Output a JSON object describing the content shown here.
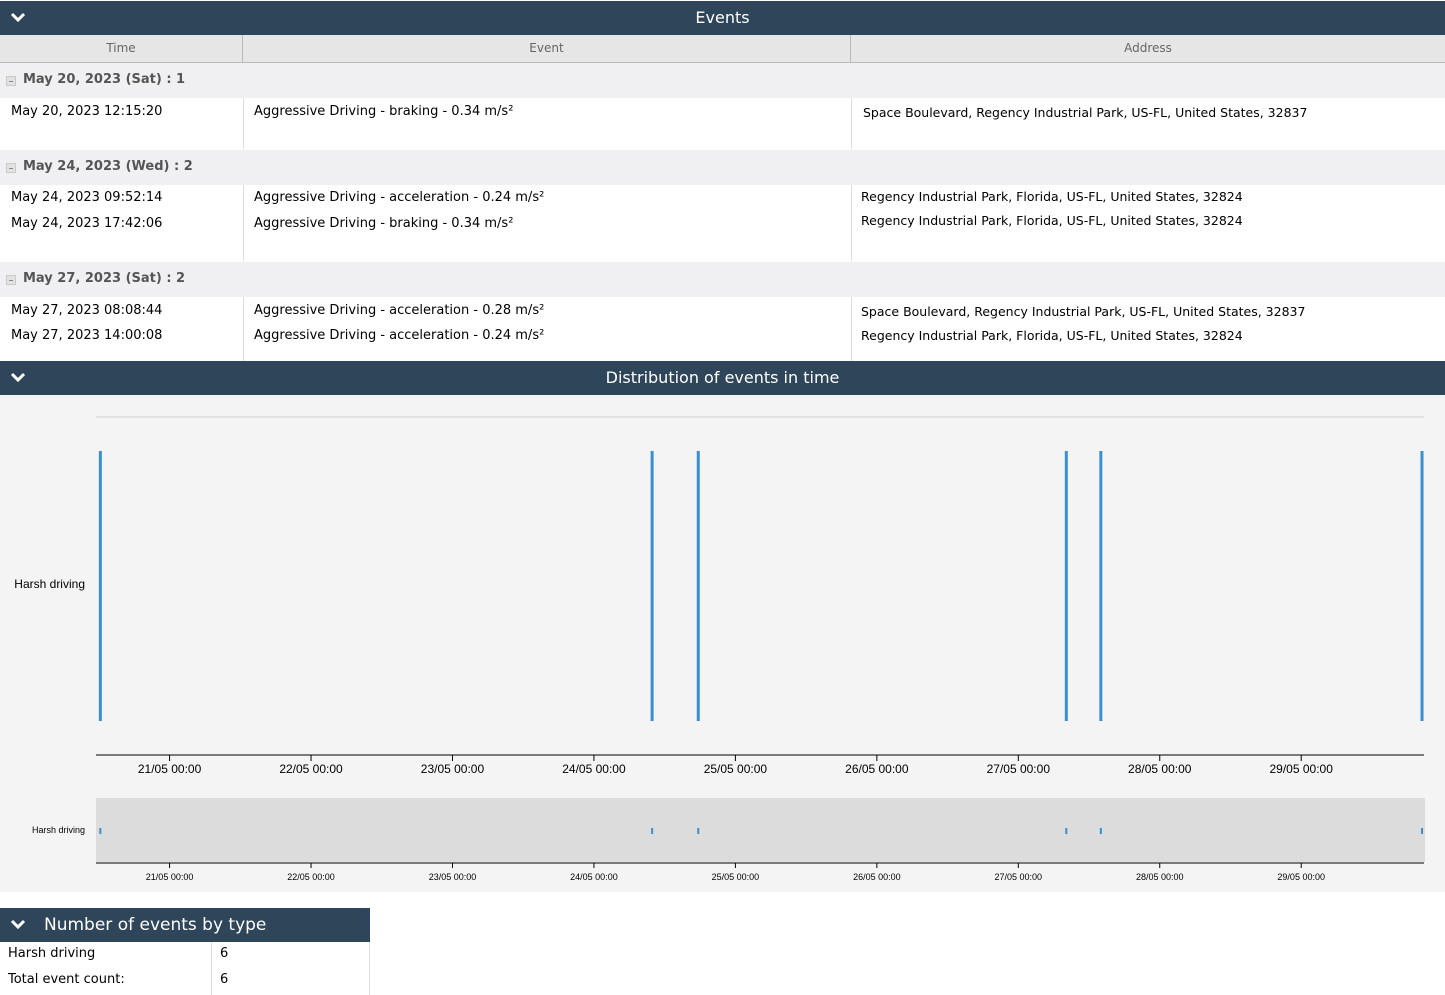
{
  "events_panel": {
    "title": "Events",
    "columns": [
      "Time",
      "Event",
      "Address"
    ],
    "groups": [
      {
        "label": "May 20, 2023 (Sat) : 1",
        "rows": [
          {
            "time": "May 20, 2023 12:15:20",
            "event": "Aggressive Driving - braking - 0.34 m/s²",
            "address": "Space Boulevard, Regency Industrial Park, US-FL, United States, 32837"
          }
        ]
      },
      {
        "label": "May 24, 2023 (Wed) : 2",
        "rows": [
          {
            "time": "May 24, 2023 09:52:14",
            "event": "Aggressive Driving - acceleration - 0.24 m/s²",
            "address": "Regency Industrial Park, Florida, US-FL, United States, 32824"
          },
          {
            "time": "May 24, 2023 17:42:06",
            "event": "Aggressive Driving - braking - 0.34 m/s²",
            "address": "Regency Industrial Park, Florida, US-FL, United States, 32824"
          }
        ]
      },
      {
        "label": "May 27, 2023 (Sat) : 2",
        "rows": [
          {
            "time": "May 27, 2023 08:08:44",
            "event": "Aggressive Driving - acceleration - 0.28 m/s²",
            "address": "Space Boulevard, Regency Industrial Park, US-FL, United States, 32837"
          },
          {
            "time": "May 27, 2023 14:00:08",
            "event": "Aggressive Driving - acceleration - 0.24 m/s²",
            "address": "Regency Industrial Park, Florida, US-FL, United States, 32824"
          }
        ]
      }
    ]
  },
  "distribution_panel": {
    "title": "Distribution of events in time"
  },
  "type_panel": {
    "title": "Number of events by type",
    "rows": [
      {
        "label": "Harsh driving",
        "value": "6"
      },
      {
        "label": "Total event count:",
        "value": "6"
      }
    ]
  },
  "chart_data": {
    "type": "scatter",
    "series": [
      {
        "name": "Harsh driving"
      }
    ],
    "categories": [
      "Harsh driving"
    ],
    "x_format": "DD/MM HH:mm",
    "x_range": [
      "2023-05-20T11:31",
      "2023-05-29T20:50"
    ],
    "x_ticks": [
      "21/05 00:00",
      "22/05 00:00",
      "23/05 00:00",
      "24/05 00:00",
      "25/05 00:00",
      "26/05 00:00",
      "27/05 00:00",
      "28/05 00:00",
      "29/05 00:00"
    ],
    "events": [
      "2023-05-20T12:15:20",
      "2023-05-24T09:52:14",
      "2023-05-24T17:42:06",
      "2023-05-27T08:08:44",
      "2023-05-27T14:00:08",
      "2023-05-29T20:30:00"
    ],
    "marker_color": "#3a8fd1",
    "overview": true
  }
}
